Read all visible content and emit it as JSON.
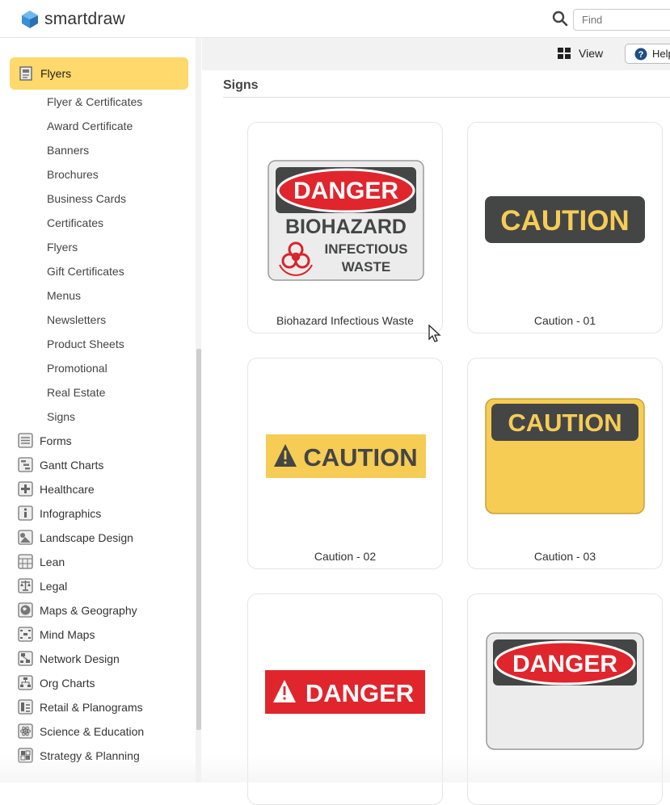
{
  "header": {
    "logo_text": "smartdraw",
    "search_placeholder": "Find",
    "search_icon": "search-icon"
  },
  "toolbar": {
    "view_label": "View",
    "help_label": "Help"
  },
  "sidebar": {
    "active": {
      "label": "Flyers",
      "icon": "flyer-icon"
    },
    "sub_items": [
      "Flyer & Certificates",
      "Award Certificate",
      "Banners",
      "Brochures",
      "Business Cards",
      "Certificates",
      "Flyers",
      "Gift Certificates",
      "Menus",
      "Newsletters",
      "Product Sheets",
      "Promotional",
      "Real Estate",
      "Signs"
    ],
    "categories": [
      {
        "label": "Forms",
        "icon": "forms-icon"
      },
      {
        "label": "Gantt Charts",
        "icon": "gantt-icon"
      },
      {
        "label": "Healthcare",
        "icon": "healthcare-icon"
      },
      {
        "label": "Infographics",
        "icon": "info-icon"
      },
      {
        "label": "Landscape Design",
        "icon": "landscape-icon"
      },
      {
        "label": "Lean",
        "icon": "lean-icon"
      },
      {
        "label": "Legal",
        "icon": "legal-icon"
      },
      {
        "label": "Maps & Geography",
        "icon": "globe-icon"
      },
      {
        "label": "Mind Maps",
        "icon": "mindmap-icon"
      },
      {
        "label": "Network Design",
        "icon": "network-icon"
      },
      {
        "label": "Org Charts",
        "icon": "orgchart-icon"
      },
      {
        "label": "Retail & Planograms",
        "icon": "retail-icon"
      },
      {
        "label": "Science & Education",
        "icon": "atom-icon"
      },
      {
        "label": "Strategy & Planning",
        "icon": "strategy-icon"
      }
    ]
  },
  "main": {
    "section_title": "Signs",
    "cards": [
      {
        "caption": "Biohazard Infectious Waste",
        "sign": {
          "top": "DANGER",
          "line1": "BIOHAZARD",
          "line2": "INFECTIOUS",
          "line3": "WASTE"
        }
      },
      {
        "caption": "Caution - 01",
        "sign": {
          "text": "CAUTION"
        }
      },
      {
        "caption": "Caution - 02",
        "sign": {
          "text": "CAUTION"
        }
      },
      {
        "caption": "Caution - 03",
        "sign": {
          "text": "CAUTION"
        }
      },
      {
        "caption": "",
        "sign": {
          "text": "DANGER"
        }
      },
      {
        "caption": "",
        "sign": {
          "text": "DANGER"
        }
      }
    ]
  },
  "colors": {
    "active_bg": "#ffd96b",
    "danger_red": "#e0252d",
    "caution_yellow": "#f6cc55",
    "sign_dark": "#444545",
    "brand_blue": "#3a8fd6"
  }
}
